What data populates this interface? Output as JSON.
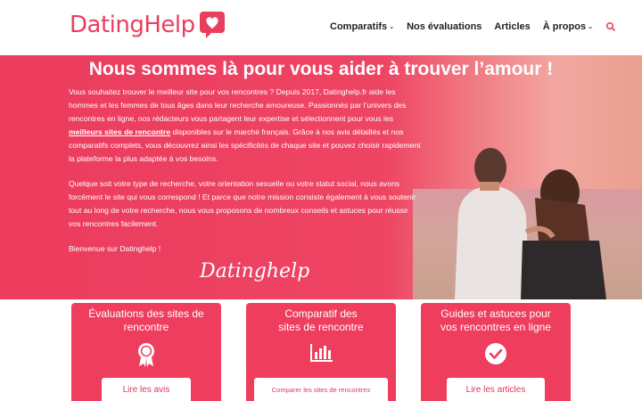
{
  "brand": {
    "name": "DatingHelp",
    "color": "#ea3e5e"
  },
  "nav": {
    "items": [
      {
        "label": "Comparatifs",
        "has_dropdown": true
      },
      {
        "label": "Nos évaluations",
        "has_dropdown": false
      },
      {
        "label": "Articles",
        "has_dropdown": false
      },
      {
        "label": "À propos",
        "has_dropdown": true
      }
    ],
    "search_icon": "search-icon"
  },
  "hero": {
    "title": "Nous sommes là pour vous aider à trouver l’amour !",
    "p1_a": "Vous souhaitez trouver le meilleur site pour vos rencontres ? Depuis 2017, Datinghelp.fr aide les hommes et les femmes de tous âges dans leur recherche amoureuse. Passionnés par l’univers des rencontres en ligne, nos rédacteurs vous partagent leur expertise et sélectionnent pour vous les ",
    "p1_link": "meilleurs sites de rencontre",
    "p1_b": " disponibles sur le marché français. Grâce à nos avis détaillés et nos comparatifs complets, vous découvrez ainsi les spécificités de chaque site et pouvez choisir rapidement la plateforme la plus adaptée à vos besoins.",
    "p2": "Quelque soit votre type de recherche, votre orientation sexuelle ou votre statut social, nous avons forcément le site qui vous correspond ! Et parce que notre mission consiste également à vous soutenir tout au long de votre recherche, nous vous proposons de nombreux conseils et astuces pour réussir vos rencontres facilement.",
    "p3": "Bienvenue sur Datinghelp !",
    "signature": "Datinghelp"
  },
  "cards": [
    {
      "title_1": "Évaluations des sites de",
      "title_2": "rencontre",
      "icon": "award-ribbon-icon",
      "button": "Lire les avis"
    },
    {
      "title_1": "Comparatif des",
      "title_2": "sites de rencontre",
      "icon": "bar-chart-icon",
      "button": "Comparer les sites de rencontres"
    },
    {
      "title_1": "Guides et astuces pour",
      "title_2": "vos rencontres en ligne",
      "icon": "check-circle-icon",
      "button": "Lire les articles"
    }
  ]
}
